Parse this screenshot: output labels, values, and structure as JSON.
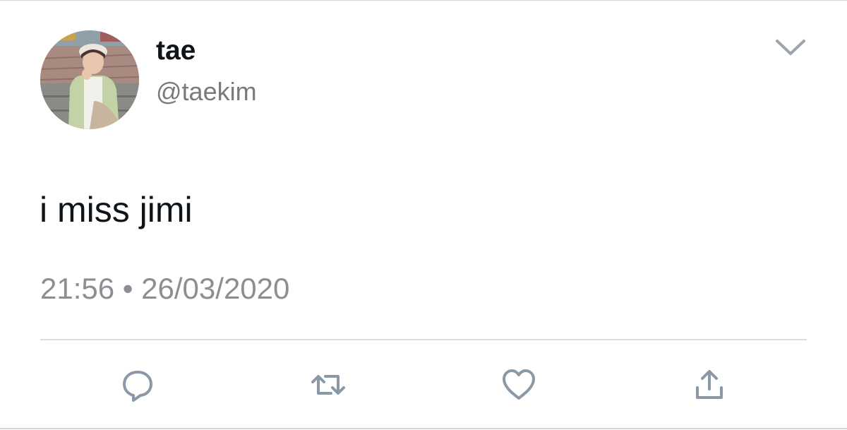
{
  "tweet": {
    "user": {
      "display_name": "tae",
      "handle": "@taekim"
    },
    "text": "i miss jimi",
    "time": "21:56",
    "separator": "•",
    "date": "26/03/2020"
  },
  "icons": {
    "menu": "chevron-down-icon",
    "reply": "reply-icon",
    "retweet": "retweet-icon",
    "like": "heart-icon",
    "share": "share-icon"
  },
  "colors": {
    "text": "#0f1419",
    "secondary": "#7a7a7a",
    "icon": "#8b99a6",
    "divider": "#dcdcdc"
  }
}
